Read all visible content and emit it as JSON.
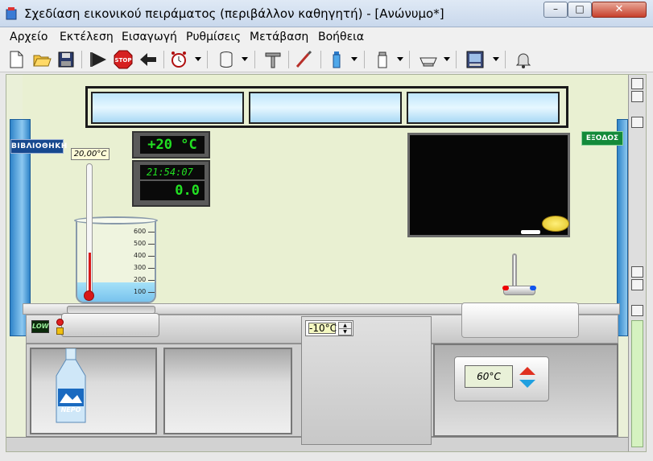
{
  "window": {
    "title": "Σχεδίαση εικονικού πειράματος (περιβάλλον καθηγητή) - [Ανώνυμο*]",
    "minimize_symbol": "–",
    "maximize_symbol": "□",
    "close_symbol": "✕"
  },
  "menu": {
    "items": [
      "Αρχείο",
      "Εκτέλεση",
      "Εισαγωγή",
      "Ρυθμίσεις",
      "Μετάβαση",
      "Βοήθεια"
    ]
  },
  "toolbar": {
    "icons": [
      "new-document",
      "open-folder",
      "save-disk",
      "run-play",
      "stop",
      "back-arrow",
      "alarm-clock",
      "beaker-cylinder",
      "pipe-stand",
      "pipette",
      "bottle",
      "salt-shaker",
      "dish",
      "panel-display",
      "bell"
    ],
    "stop_label": "STOP"
  },
  "lab": {
    "library_sign": "ΒΙΒΛΙΟΘΗΚΗ",
    "exit_sign": "ΕΞΟΔΟΣ",
    "temperature_display": "+20 °C",
    "timer_time": "21:54:07",
    "timer_reading": "0.0",
    "thermometer_label": "20,00°C",
    "beaker_ticks": [
      "600",
      "500",
      "400",
      "300",
      "200",
      "100"
    ],
    "hotplate_indicator": "LOW",
    "freezer_value": "-10°C",
    "heater_value": "60°C",
    "bottle_label": "ΝΕΡΟ"
  },
  "colors": {
    "display_green": "#22e022",
    "wall": "#e9f0d2",
    "blackboard": "#060606",
    "door_blue": "#2f84c9",
    "exit_green": "#138a3a"
  }
}
